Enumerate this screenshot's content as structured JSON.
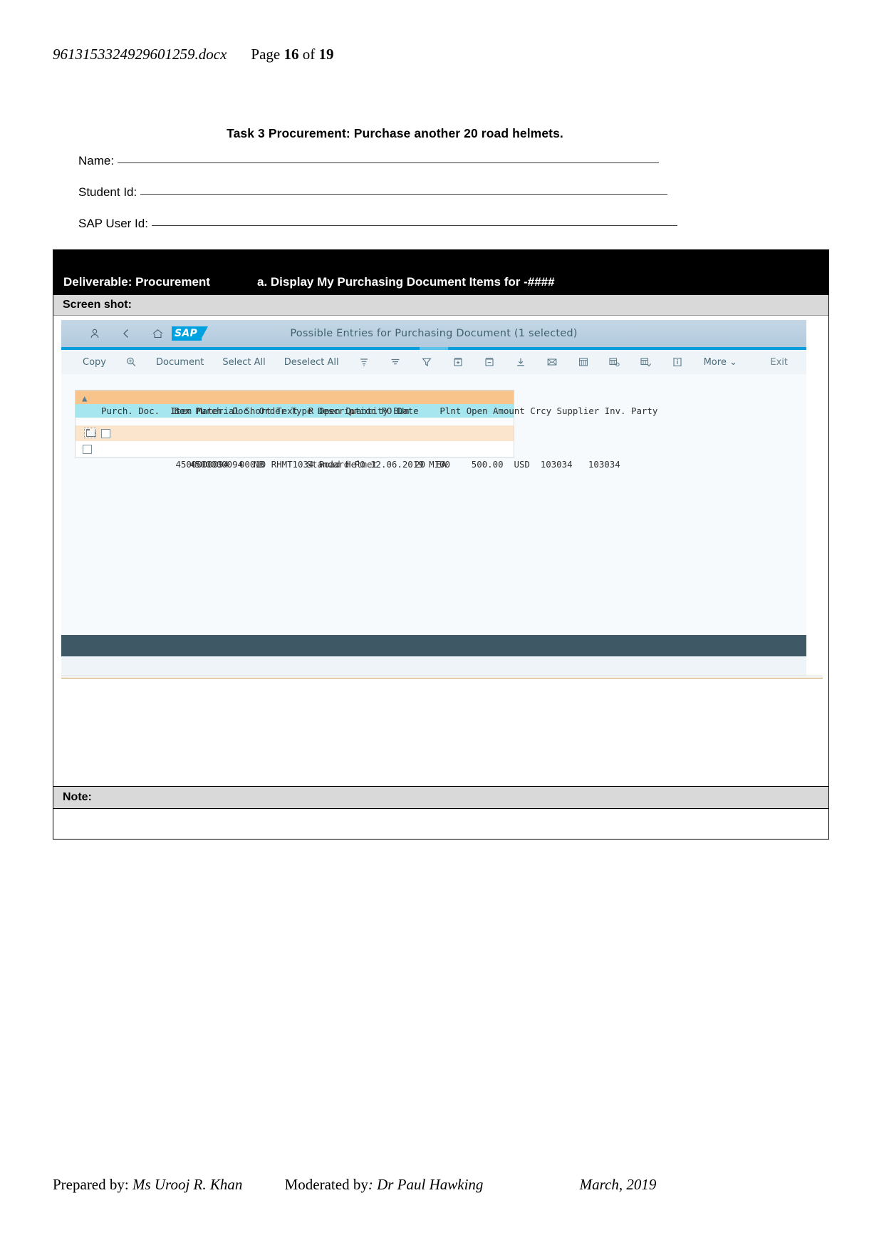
{
  "running_head": {
    "filename": "9613153324929601259.docx",
    "page_prefix": "Page ",
    "page_number": "16",
    "page_of": " of ",
    "page_total": "19"
  },
  "task": {
    "title": "Task 3 Procurement: Purchase another 20 road helmets."
  },
  "form_fields": [
    {
      "label": "Name:",
      "value": ""
    },
    {
      "label": "Student Id:",
      "value": ""
    },
    {
      "label": "SAP User Id:",
      "value": ""
    }
  ],
  "deliverable": {
    "left_label": "Deliverable: Procurement",
    "right_label": "a. Display My Purchasing Document Items for -####",
    "screenshot_label": "Screen shot:",
    "note_label": "Note:"
  },
  "sap": {
    "shell": {
      "icons": [
        "user-icon",
        "back-icon",
        "home-icon"
      ],
      "logo_text": "SAP",
      "title": "Possible Entries for Purchasing Document (1 selected)"
    },
    "toolbar": {
      "items": [
        {
          "type": "text",
          "label": "Copy",
          "name": "copy-button"
        },
        {
          "type": "icon",
          "label": "search-icon",
          "name": "search-icon"
        },
        {
          "type": "text",
          "label": "Document",
          "name": "document-button"
        },
        {
          "type": "text",
          "label": "Select All",
          "name": "select-all-button"
        },
        {
          "type": "text",
          "label": "Deselect All",
          "name": "deselect-all-button"
        },
        {
          "type": "icon",
          "label": "sort-icon",
          "name": "sort-icon"
        },
        {
          "type": "icon",
          "label": "group-icon",
          "name": "group-icon"
        },
        {
          "type": "icon",
          "label": "filter-icon",
          "name": "filter-icon"
        },
        {
          "type": "icon",
          "label": "expand-icon",
          "name": "expand-icon"
        },
        {
          "type": "icon",
          "label": "collapse-icon",
          "name": "collapse-icon"
        },
        {
          "type": "icon",
          "label": "download-icon",
          "name": "download-icon"
        },
        {
          "type": "icon",
          "label": "mail-icon",
          "name": "mail-icon"
        },
        {
          "type": "icon",
          "label": "spreadsheet-icon",
          "name": "spreadsheet-icon"
        },
        {
          "type": "icon",
          "label": "layout-save-icon",
          "name": "layout-save-icon"
        },
        {
          "type": "icon",
          "label": "layout-select-icon",
          "name": "layout-select-icon"
        },
        {
          "type": "icon",
          "label": "info-icon",
          "name": "info-icon"
        }
      ],
      "more_label": "More",
      "more_chevron": "⌄",
      "exit_label": "Exit"
    },
    "table": {
      "header_main": "Box Purch. Doc. Order Type Description PO Date    Plnt Open Amount Crcy Supplier Inv. Party",
      "header_sub": "Purch. Doc.  Item Material Short Text  R Open Quantity BUn",
      "rows": [
        {
          "kind": "header-row",
          "text": "4500000094  NB        Standard PO 12.06.2019 MI00    500.00  USD  103034   103034"
        },
        {
          "kind": "item-row",
          "text": "4500000094  00010 RHMT1034 Road Helmet       20  EA"
        }
      ]
    }
  },
  "doc_footer": {
    "prepared_label": "Prepared by:",
    "prepared_name": "Ms Urooj R. Khan",
    "moderated_label": "Moderated by",
    "moderated_name": ": Dr Paul Hawking",
    "date": "March, 2019"
  },
  "colors": {
    "header_orange": "#f9c48b",
    "header_cyan": "#a6e6ef",
    "row_highlight": "#fce5cd",
    "sap_blue": "#00a1e0",
    "accent": "#0a9ddb"
  }
}
